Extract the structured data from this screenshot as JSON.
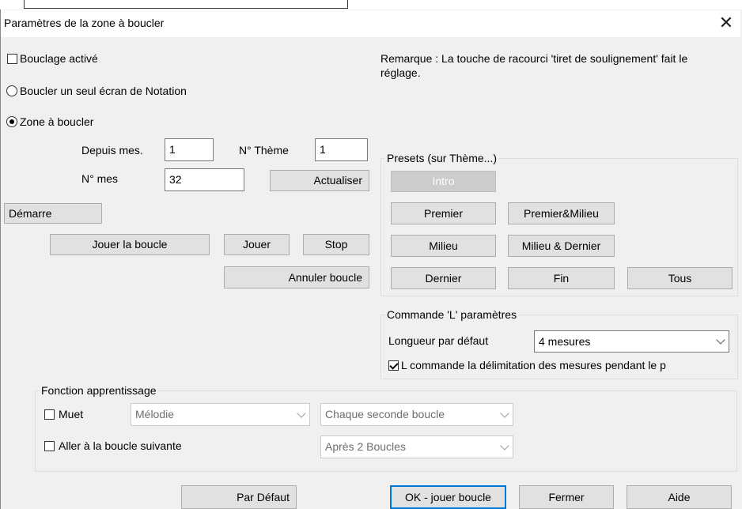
{
  "window": {
    "title": "Paramètres de la zone à boucler",
    "close_glyph": "✕"
  },
  "options": {
    "loop_enabled": {
      "label": "Bouclage activé",
      "checked": false
    },
    "loop_single_screen": {
      "label": "Boucler un seul écran de Notation",
      "selected": false
    },
    "loop_zone": {
      "label": "Zone à boucler",
      "selected": true
    }
  },
  "note": {
    "line1": "Remarque : La touche de racourci 'tiret de soulignement' fait le",
    "line2": "réglage."
  },
  "range": {
    "from_label": "Depuis mes.",
    "from_value": "1",
    "theme_label": "N° Thème",
    "theme_value": "1",
    "count_label": "N° mes",
    "count_value": "32",
    "refresh_button": "Actualiser"
  },
  "buttons": {
    "start": "Démarre",
    "play_loop": "Jouer la boucle",
    "play": "Jouer",
    "stop": "Stop",
    "cancel_loop": "Annuler boucle",
    "defaults": "Par Défaut",
    "ok": "OK - jouer boucle",
    "close": "Fermer",
    "help": "Aide"
  },
  "presets": {
    "legend": "Presets (sur Thème...)",
    "intro": "Intro",
    "first": "Premier",
    "first_middle": "Premier&Milieu",
    "middle": "Milieu",
    "middle_last": "Milieu & Dernier",
    "last": "Dernier",
    "end": "Fin",
    "all": "Tous"
  },
  "lcommand": {
    "legend": "Commande 'L' paramètres",
    "length_label": "Longueur par défaut",
    "length_value": "4 mesures",
    "delimit_label": "L commande la délimitation des mesures pendant le p",
    "delimit_checked": true
  },
  "learning": {
    "legend": "Fonction apprentissage",
    "mute_label": "Muet",
    "mute_checked": false,
    "track_value": "Mélodie",
    "every_value": "Chaque seconde boucle",
    "next_label": "Aller à la boucle suivante",
    "next_checked": false,
    "after_value": "Après 2 Boucles"
  }
}
